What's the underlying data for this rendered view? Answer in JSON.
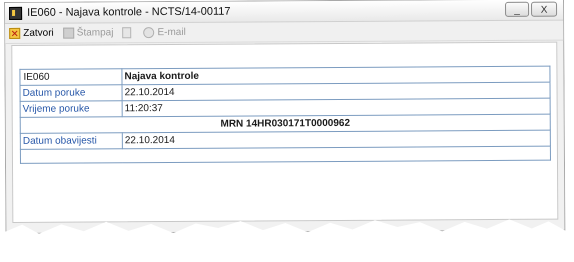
{
  "window": {
    "title": "IE060 - Najava kontrole - NCTS/14-00117",
    "minimize": "_",
    "close": "X"
  },
  "toolbar": {
    "close_label": "Zatvori",
    "print_label": "Štampaj",
    "email_label": "E-mail"
  },
  "document": {
    "code": "IE060",
    "title": "Najava kontrole",
    "rows": [
      {
        "label": "Datum poruke",
        "value": "22.10.2014"
      },
      {
        "label": "Vrijeme poruke",
        "value": "11:20:37"
      }
    ],
    "mrn": "MRN 14HR030171T0000962",
    "notify": {
      "label": "Datum obavijesti",
      "value": "22.10.2014"
    }
  },
  "colors": {
    "accent_orange": "#f07a10",
    "label_blue": "#2757a8",
    "border_blue": "#7c9cc0"
  }
}
